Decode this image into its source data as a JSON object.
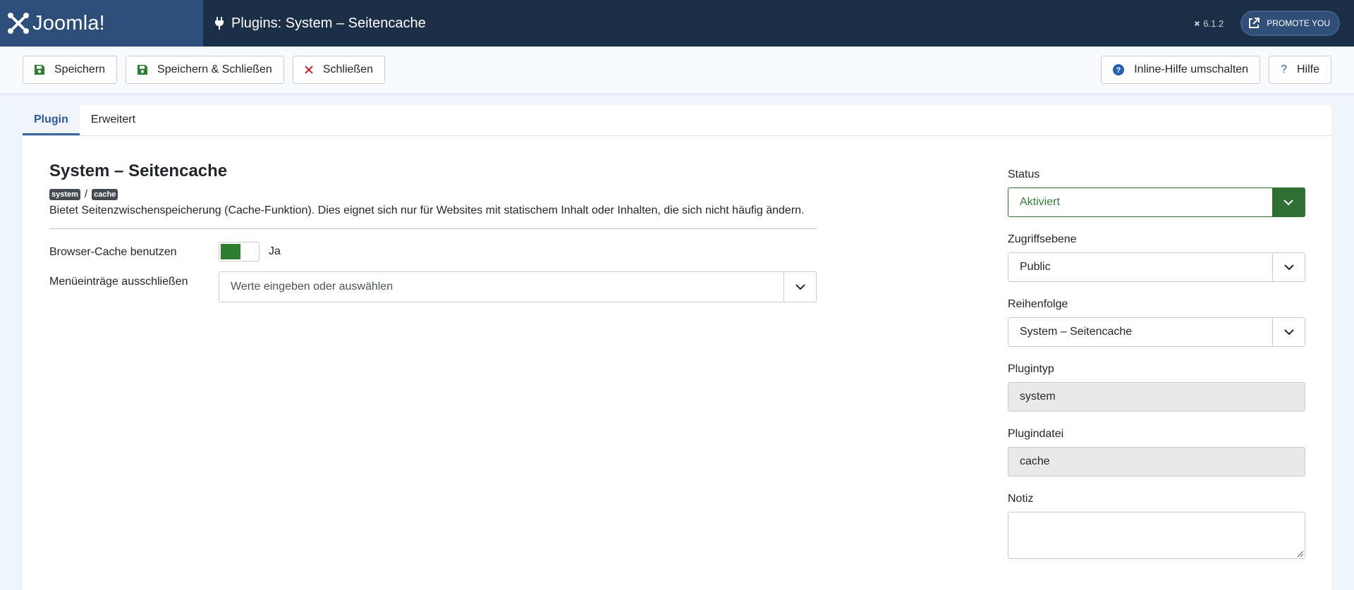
{
  "app": {
    "logo_text": "Joomla!",
    "page_title": "Plugins: System – Seitencache",
    "version": "6.1.2",
    "promote_label": "PROMOTE YOU"
  },
  "toolbar": {
    "save_label": "Speichern",
    "save_close_label": "Speichern & Schließen",
    "close_label": "Schließen",
    "inline_help_label": "Inline-Hilfe umschalten",
    "help_label": "Hilfe"
  },
  "tabs": [
    {
      "label": "Plugin",
      "active": true
    },
    {
      "label": "Erweitert",
      "active": false
    }
  ],
  "plugin": {
    "title": "System – Seitencache",
    "badge_group": "system",
    "badge_element": "cache",
    "separator": "/",
    "description": "Bietet Seitenzwischenspeicherung (Cache-Funktion). Dies eignet sich nur für Websites mit statischem Inhalt oder Inhalten, die sich nicht häufig ändern."
  },
  "fields": {
    "browser_cache": {
      "label": "Browser-Cache benutzen",
      "value": "Ja",
      "enabled": true
    },
    "exclude_menu": {
      "label": "Menüeinträge ausschließen",
      "placeholder": "Werte eingeben oder auswählen"
    }
  },
  "side": {
    "status": {
      "label": "Status",
      "value": "Aktiviert"
    },
    "access": {
      "label": "Zugriffsebene",
      "value": "Public"
    },
    "ordering": {
      "label": "Reihenfolge",
      "value": "System – Seitencache"
    },
    "plugin_type": {
      "label": "Plugintyp",
      "value": "system"
    },
    "plugin_file": {
      "label": "Plugindatei",
      "value": "cache"
    },
    "note": {
      "label": "Notiz",
      "value": ""
    }
  },
  "colors": {
    "header_bg": "#1c2e45",
    "logo_bg": "#2d4e78",
    "status_green": "#2f7d32",
    "save_icon": "#2f7d32",
    "close_icon": "#c52827",
    "help_icon": "#2a5fb0",
    "active_tab": "#2a5995"
  }
}
